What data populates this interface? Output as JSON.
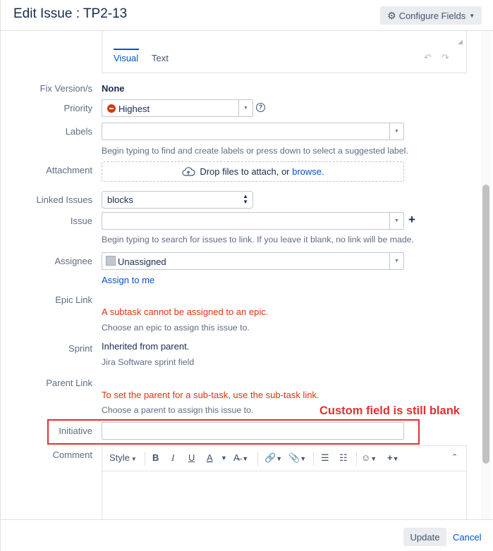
{
  "dialog": {
    "title": "Edit Issue : TP2-13",
    "configure_label": "Configure Fields"
  },
  "description": {
    "tab_visual": "Visual",
    "tab_text": "Text",
    "undo_icon": "undo-icon",
    "redo_icon": "redo-icon"
  },
  "fields": {
    "fix_version": {
      "label": "Fix Version/s",
      "value": "None"
    },
    "priority": {
      "label": "Priority",
      "value": "Highest",
      "icon": "priority-highest-icon",
      "color": "#de350b"
    },
    "labels": {
      "label": "Labels",
      "value": "",
      "help": "Begin typing to find and create labels or press down to select a suggested label."
    },
    "attachment": {
      "label": "Attachment",
      "drop_text": "Drop files to attach, or ",
      "browse": "browse."
    },
    "linked_issues": {
      "label": "Linked Issues",
      "value": "blocks"
    },
    "issue": {
      "label": "Issue",
      "value": "",
      "help": "Begin typing to search for issues to link. If you leave it blank, no link will be made."
    },
    "assignee": {
      "label": "Assignee",
      "value": "Unassigned",
      "assign_to_me": "Assign to me"
    },
    "epic_link": {
      "label": "Epic Link",
      "error": "A subtask cannot be assigned to an epic.",
      "help": "Choose an epic to assign this issue to."
    },
    "sprint": {
      "label": "Sprint",
      "value": "Inherited from parent.",
      "help": "Jira Software sprint field"
    },
    "parent_link": {
      "label": "Parent Link",
      "error": "To set the parent for a sub-task, use the sub-task link.",
      "help": "Choose a parent to assign this issue to."
    },
    "initiative": {
      "label": "Initiative",
      "value": ""
    },
    "comment": {
      "label": "Comment"
    }
  },
  "annotation": {
    "text": "Custom field is still blank",
    "color": "#e03131"
  },
  "comment_toolbar": {
    "style_label": "Style",
    "bold": "B",
    "italic": "I",
    "underline": "U",
    "text_color": "A"
  },
  "footer": {
    "update_label": "Update",
    "cancel_label": "Cancel"
  },
  "colors": {
    "link": "#0052cc",
    "error": "#de350b",
    "label": "#5e6c84"
  }
}
